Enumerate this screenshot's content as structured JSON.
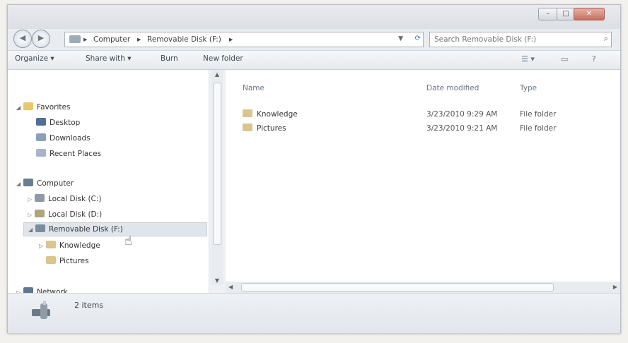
{
  "address_bar": {
    "crumbs": [
      "Computer",
      "Removable Disk (F:)"
    ]
  },
  "search": {
    "placeholder": "Search Removable Disk (F:)"
  },
  "toolbar": {
    "organize": "Organize ▾",
    "share_with": "Share with ▾",
    "burn": "Burn",
    "new_folder": "New folder"
  },
  "nav": {
    "favorites": "Favorites",
    "desktop": "Desktop",
    "downloads": "Downloads",
    "recent_places": "Recent Places",
    "computer": "Computer",
    "local_c": "Local Disk (C:)",
    "local_d": "Local Disk (D:)",
    "removable": "Removable Disk (F:)",
    "knowledge": "Knowledge",
    "pictures": "Pictures",
    "network": "Network"
  },
  "file_list": {
    "headers": {
      "name": "Name",
      "date_modified": "Date modified",
      "type": "Type"
    },
    "rows": [
      {
        "name": "Knowledge",
        "date": "3/23/2010 9:29 AM",
        "type": "File folder"
      },
      {
        "name": "Pictures",
        "date": "3/23/2010 9:21 AM",
        "type": "File folder"
      }
    ]
  },
  "status": {
    "item_count": "2 items"
  },
  "colors": {
    "accent": "#3872b6",
    "folder": "#d9c58d"
  },
  "icons": {
    "back": "back-arrow-icon",
    "forward": "forward-arrow-icon",
    "search": "search-icon",
    "refresh": "refresh-icon",
    "help": "help-icon",
    "preview": "preview-pane-icon",
    "views": "views-icon",
    "cursor": "hand-cursor-icon",
    "status": "usb-drive-icon"
  }
}
